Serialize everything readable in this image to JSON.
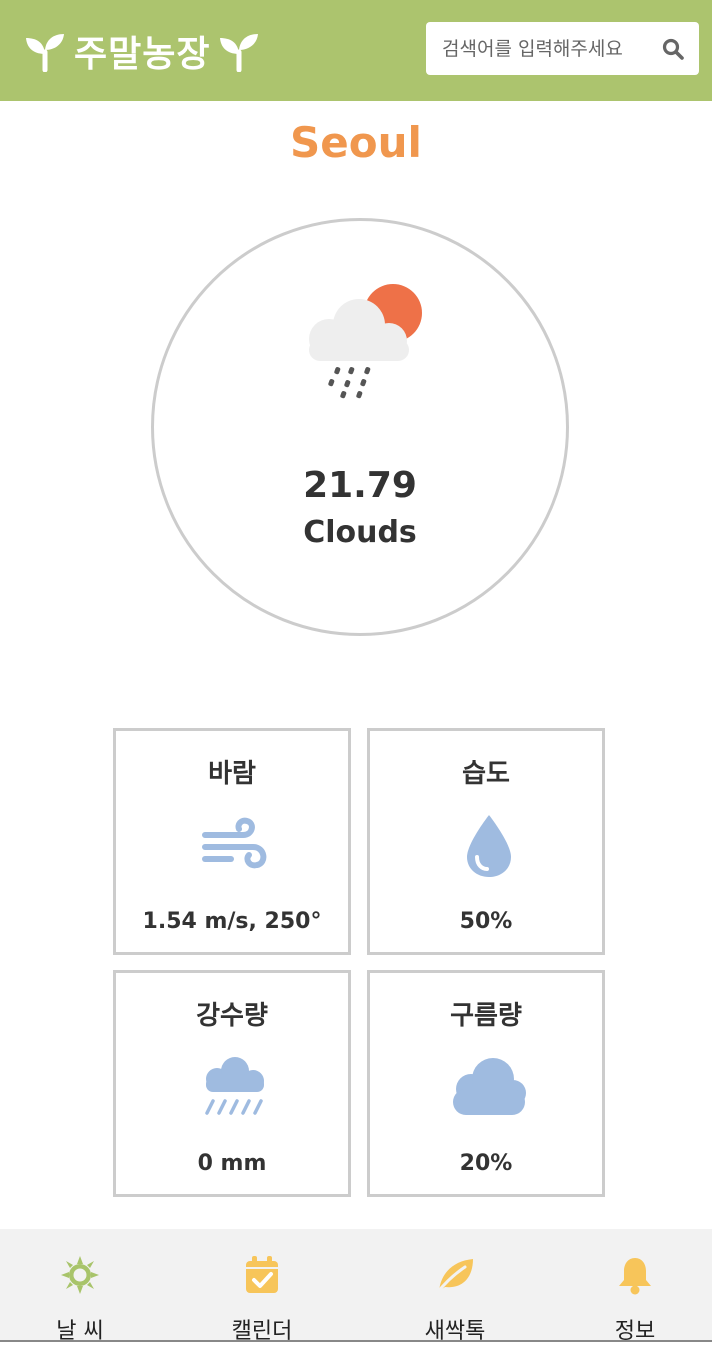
{
  "header": {
    "brand": "주말농장",
    "search_placeholder": "검색어를 입력해주세요",
    "left_icon": "sprout-icon",
    "right_icon": "sprout-icon"
  },
  "weather": {
    "city": "Seoul",
    "icon": "cloud-sun-rain-icon",
    "temperature": "21.79",
    "description": "Clouds"
  },
  "cards": [
    {
      "title": "바람",
      "icon": "wind-icon",
      "value": "1.54 m/s, 250°"
    },
    {
      "title": "습도",
      "icon": "water-drop-icon",
      "value": "50%"
    },
    {
      "title": "강수량",
      "icon": "rain-cloud-icon",
      "value": "0 mm"
    },
    {
      "title": "구름량",
      "icon": "cloud-icon",
      "value": "20%"
    }
  ],
  "nav": [
    {
      "label": "날  씨",
      "icon": "sun-icon"
    },
    {
      "label": "캘린더",
      "icon": "calendar-check-icon"
    },
    {
      "label": "새싹톡",
      "icon": "leaf-icon"
    },
    {
      "label": "정보",
      "icon": "bell-icon"
    }
  ],
  "colors": {
    "header_bg": "#acc46e",
    "city_text": "#f0974e",
    "card_icon": "#9fbbe0",
    "nav_bg": "#f2f2f2",
    "nav_icon_green": "#a8c46a",
    "nav_icon_orange": "#f7c55a",
    "sun_orange": "#ee7148"
  }
}
